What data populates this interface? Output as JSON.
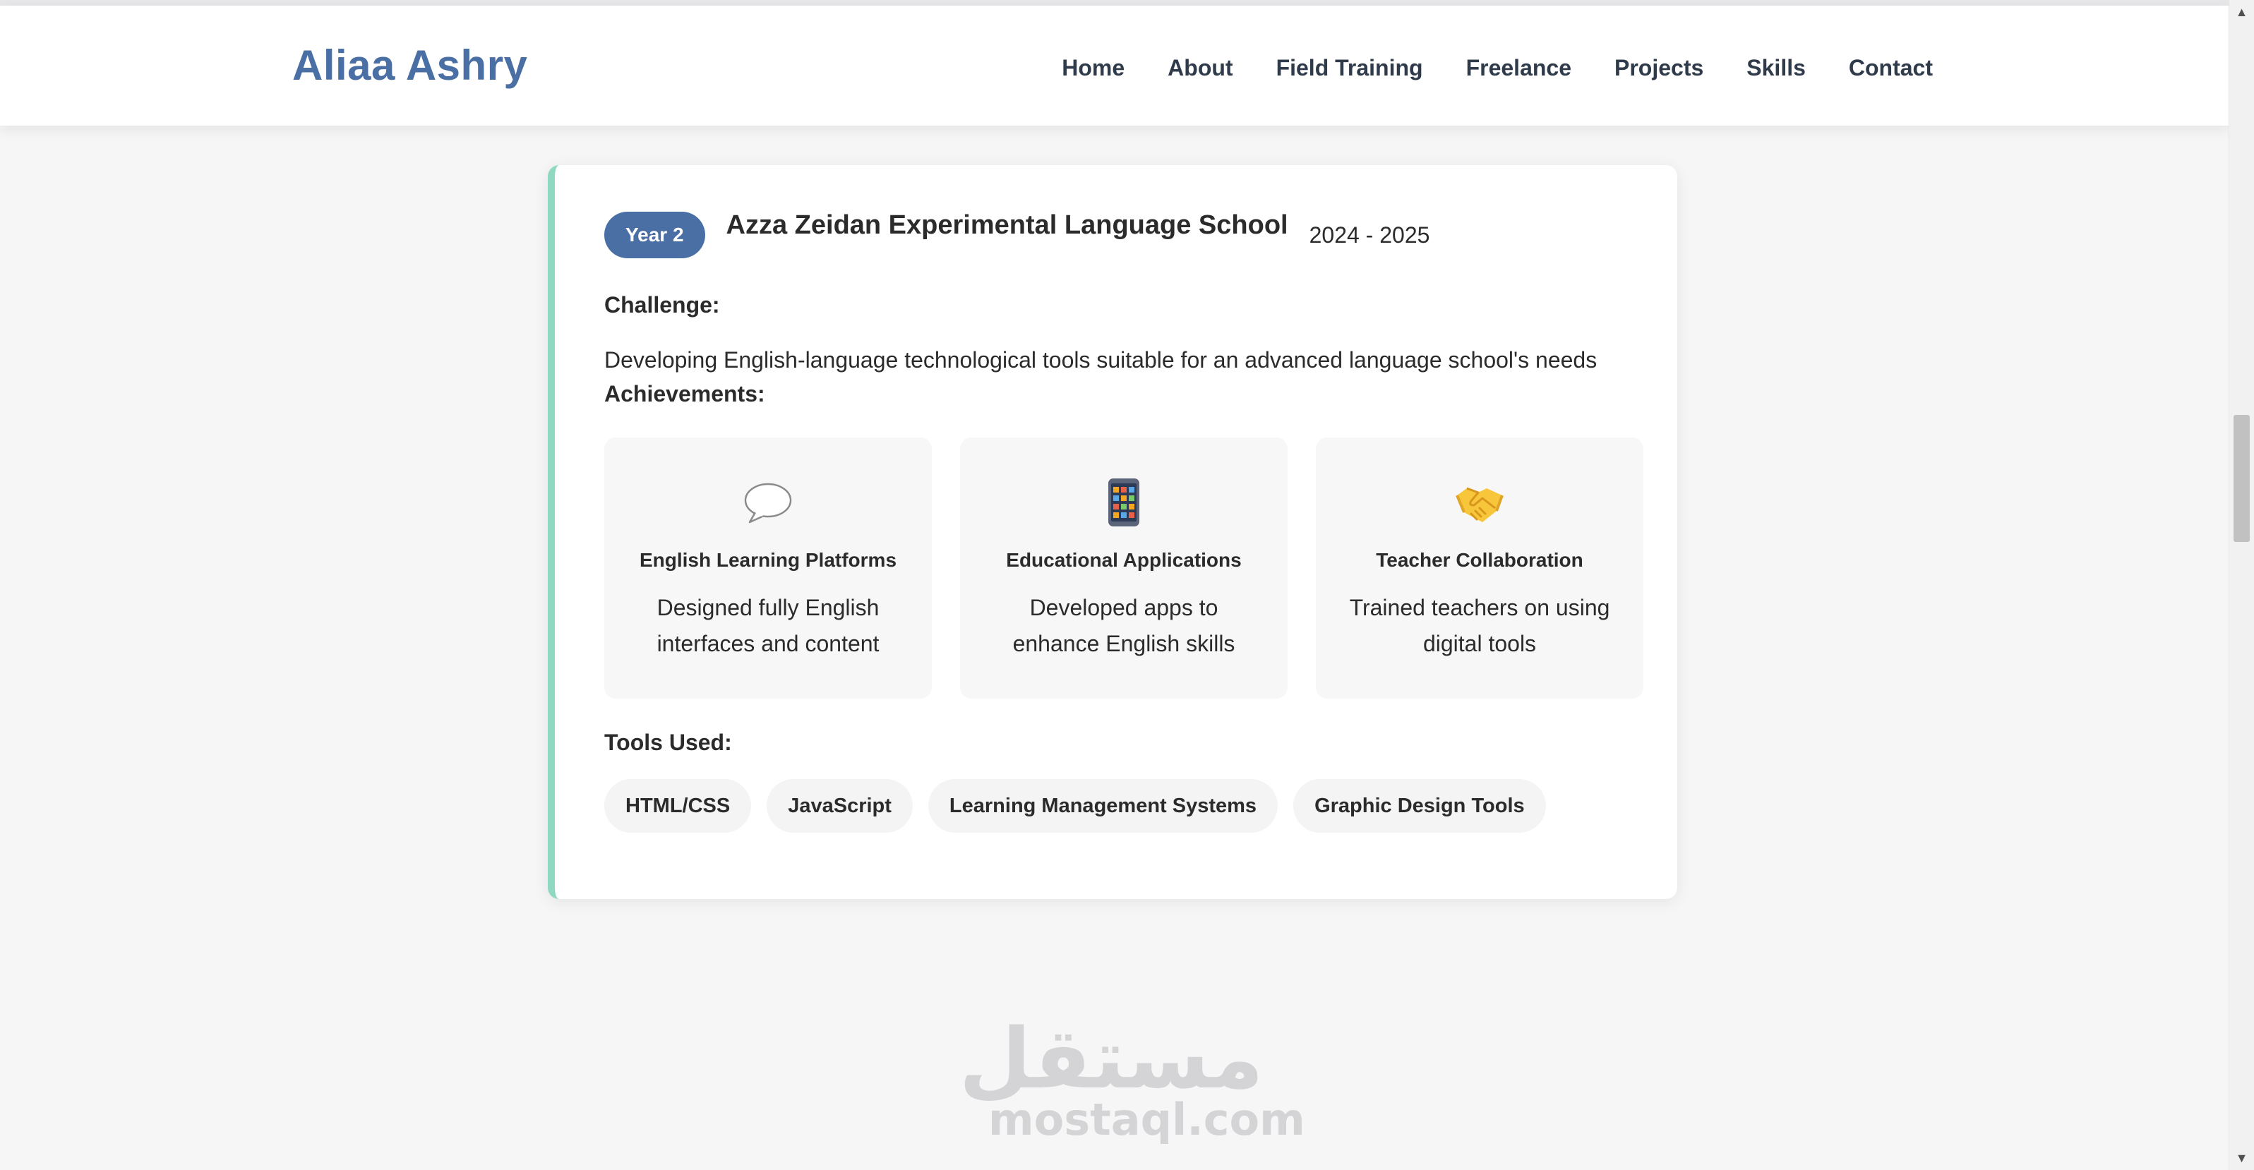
{
  "header": {
    "logo": "Aliaa Ashry",
    "nav": [
      "Home",
      "About",
      "Field Training",
      "Freelance",
      "Projects",
      "Skills",
      "Contact"
    ]
  },
  "card": {
    "year_badge": "Year 2",
    "school": "Azza Zeidan Experimental Language School",
    "years": "2024 - 2025",
    "challenge_label": "Challenge:",
    "challenge_text": "Developing English-language technological tools suitable for an advanced language school's needs",
    "achievements_label": "Achievements:",
    "achievements": [
      {
        "icon": "speech-bubble-icon",
        "title": "English Learning Platforms",
        "desc": "Designed fully English interfaces and content"
      },
      {
        "icon": "tablet-app-icon",
        "title": "Educational Applications",
        "desc": "Developed apps to enhance English skills"
      },
      {
        "icon": "handshake-icon",
        "title": "Teacher Collaboration",
        "desc": "Trained teachers on using digital tools"
      }
    ],
    "tools_label": "Tools Used:",
    "tools": [
      "HTML/CSS",
      "JavaScript",
      "Learning Management Systems",
      "Graphic Design Tools"
    ]
  },
  "watermark": {
    "arabic": "مستقل",
    "latin": "mostaql.com"
  },
  "colors": {
    "brand": "#4a6fa5",
    "accent": "#8fd8c2",
    "text": "#2b2b2b"
  }
}
